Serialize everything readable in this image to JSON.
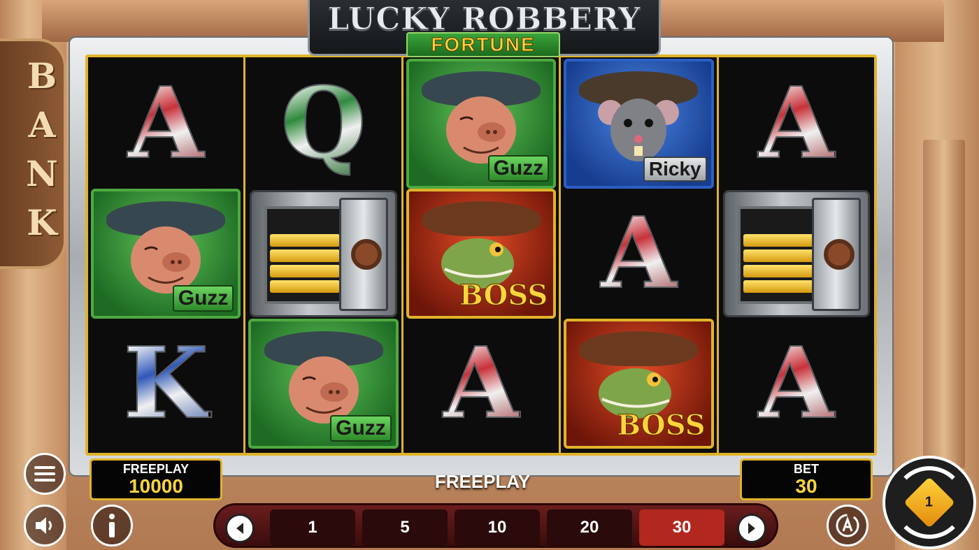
{
  "logo": {
    "title": "LUCKY ROBBERY",
    "subtitle": "FORTUNE"
  },
  "building": {
    "sign_letters": [
      "B",
      "A",
      "N",
      "K"
    ]
  },
  "reels": [
    [
      {
        "type": "letter",
        "text": "A",
        "color": "red"
      },
      {
        "type": "character",
        "character": "pig",
        "label": "Guzz"
      },
      {
        "type": "letter",
        "text": "K",
        "color": "blue"
      }
    ],
    [
      {
        "type": "letter",
        "text": "Q",
        "color": "green"
      },
      {
        "type": "safe"
      },
      {
        "type": "character",
        "character": "pig",
        "label": "Guzz"
      }
    ],
    [
      {
        "type": "character",
        "character": "pig",
        "label": "Guzz"
      },
      {
        "type": "character",
        "character": "croc",
        "label": "BOSS"
      },
      {
        "type": "letter",
        "text": "A",
        "color": "red"
      }
    ],
    [
      {
        "type": "character",
        "character": "rat",
        "label": "Ricky"
      },
      {
        "type": "letter",
        "text": "A",
        "color": "red"
      },
      {
        "type": "character",
        "character": "croc",
        "label": "BOSS"
      }
    ],
    [
      {
        "type": "letter",
        "text": "A",
        "color": "red"
      },
      {
        "type": "safe"
      },
      {
        "type": "letter",
        "text": "A",
        "color": "red"
      }
    ]
  ],
  "balance": {
    "label": "FREEPLAY",
    "value": "10000"
  },
  "bet": {
    "label": "BET",
    "value": "30"
  },
  "status": "FREEPLAY",
  "bet_options": [
    "1",
    "5",
    "10",
    "20",
    "30"
  ],
  "selected_bet": "30",
  "spin_button": {
    "text": "1"
  },
  "colors": {
    "frame_gold": "#e0b32a",
    "value_yellow": "#ffd43b",
    "selected_bet": "#b3281e",
    "pig_bg": "#2e8a2a",
    "rat_bg": "#2b5fc4",
    "croc_bg": "#c7361a"
  },
  "icons": {
    "menu": "hamburger-icon",
    "sound": "speaker-icon",
    "info": "info-icon",
    "autoplay": "autoplay-icon",
    "prev": "chevron-left-icon",
    "next": "chevron-right-icon",
    "spin": "spin-icon"
  }
}
